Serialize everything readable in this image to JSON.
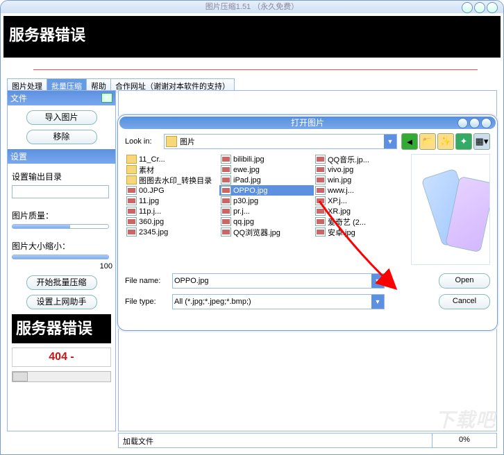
{
  "outer_title": "图片压缩1.51 （永久免费）",
  "banner_error": "服务器错误",
  "tabs": [
    "图片处理",
    "批量压缩",
    "帮助",
    "合作网址（谢谢对本软件的支持）"
  ],
  "left": {
    "file_hdr": "文件",
    "import_btn": "导入图片",
    "remove_btn": "移除",
    "settings_hdr": "设置",
    "out_dir_lbl": "设置输出目录",
    "quality_lbl": "图片质量：",
    "shrink_lbl": "图片大小缩小：",
    "shrink_val": "100",
    "start_btn": "开始批量压缩",
    "helper_btn": "设置上网助手",
    "err_card": "服务器错误",
    "code": "404 -"
  },
  "status": {
    "label": "加载文件",
    "pct": "0%"
  },
  "dialog": {
    "title": "打开图片",
    "lookin_lbl": "Look in:",
    "lookin_val": "图片",
    "col1": [
      {
        "t": "folder",
        "n": "11_Cr..."
      },
      {
        "t": "folder",
        "n": "素材"
      },
      {
        "t": "folder",
        "n": "图图去水印_转换目录"
      },
      {
        "t": "img",
        "n": "00.JPG"
      },
      {
        "t": "img",
        "n": "11.jpg"
      },
      {
        "t": "img",
        "n": "11p.j..."
      },
      {
        "t": "img",
        "n": "360.jpg"
      },
      {
        "t": "img",
        "n": "2345.jpg"
      }
    ],
    "col2": [
      {
        "t": "img",
        "n": "bilibili.jpg"
      },
      {
        "t": "img",
        "n": "ewe.jpg"
      },
      {
        "t": "img",
        "n": "iPad.jpg"
      },
      {
        "t": "img",
        "n": "OPPO.jpg",
        "sel": true
      },
      {
        "t": "img",
        "n": "p30.jpg"
      },
      {
        "t": "img",
        "n": "pr.j..."
      },
      {
        "t": "img",
        "n": "qq.jpg"
      },
      {
        "t": "img",
        "n": "QQ浏览器.jpg"
      }
    ],
    "col3": [
      {
        "t": "img",
        "n": "QQ音乐.jp..."
      },
      {
        "t": "img",
        "n": "vivo.jpg"
      },
      {
        "t": "img",
        "n": "win.jpg"
      },
      {
        "t": "img",
        "n": "www.j..."
      },
      {
        "t": "img",
        "n": "XP.j..."
      },
      {
        "t": "img",
        "n": "XR.jpg"
      },
      {
        "t": "img",
        "n": "爱奇艺 (2..."
      },
      {
        "t": "img",
        "n": "安卓.jpg"
      }
    ],
    "fname_lbl": "File name:",
    "fname_val": "OPPO.jpg",
    "ftype_lbl": "File type:",
    "ftype_val": "All (*.jpg;*.jpeg;*.bmp;)",
    "open_btn": "Open",
    "cancel_btn": "Cancel"
  },
  "watermark": "下载吧"
}
